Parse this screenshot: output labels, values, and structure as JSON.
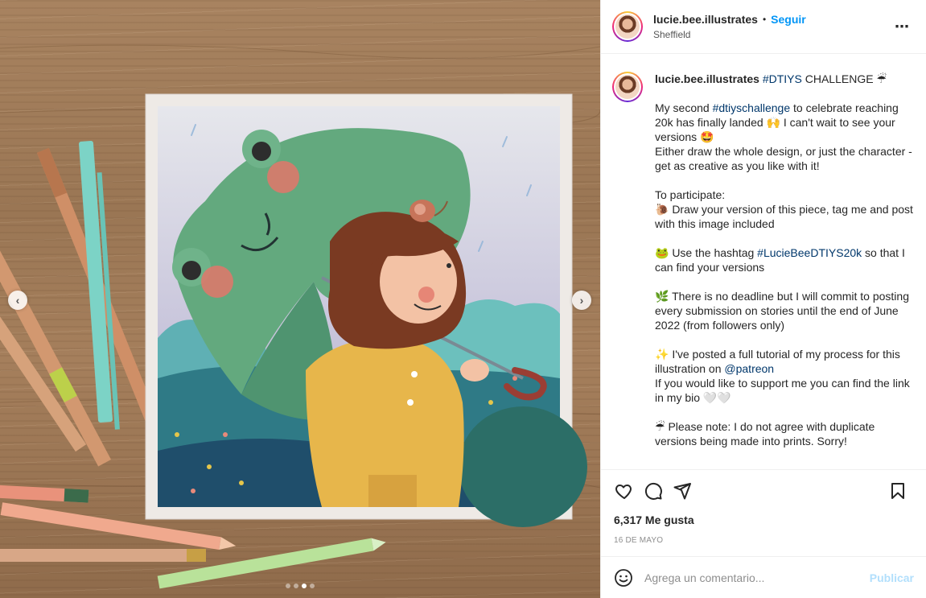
{
  "post": {
    "username": "lucie.bee.illustrates",
    "separator": "•",
    "follow_label": "Seguir",
    "location": "Sheffield",
    "more_icon": "⋯"
  },
  "caption": {
    "username": "lucie.bee.illustrates",
    "title_tag": "#DTIYS",
    "title_rest": " CHALLENGE ☔",
    "p1_a": "My second ",
    "p1_tag": "#dtiyschallenge",
    "p1_b": " to celebrate reaching 20k has finally landed 🙌 I can't wait to see your versions 🤩\nEither draw the whole design, or just the character - get as creative as you like with it!\n\nTo participate:\n🐌 Draw your version of this piece, tag me and post with this image included\n\n🐸 Use the hashtag ",
    "p2_tag": "#LucieBeeDTIYS20k",
    "p2_b": " so that I can find your versions\n\n🌿 There is no deadline but I will commit to posting every submission on stories until the end of June 2022 (from followers only)\n\n✨ I've posted a full tutorial of my process for this illustration on ",
    "p3_tag": "@patreon",
    "p3_b": "\nIf you would like to support me you can find the link in my bio 🤍🤍\n\n☔ Please note: I do not agree with duplicate versions being made into prints. Sorry!"
  },
  "stats": {
    "likes": "6,317 Me gusta",
    "date": "16 DE MAYO"
  },
  "comment": {
    "placeholder": "Agrega un comentario...",
    "publish_label": "Publicar"
  },
  "carousel": {
    "prev_icon": "‹",
    "next_icon": "›",
    "total_slides": 4,
    "active_slide": 3
  },
  "colors": {
    "accent": "#0095f6",
    "link": "#00376b",
    "muted": "#8e8e8e",
    "publish_disabled": "#b2dffc"
  }
}
